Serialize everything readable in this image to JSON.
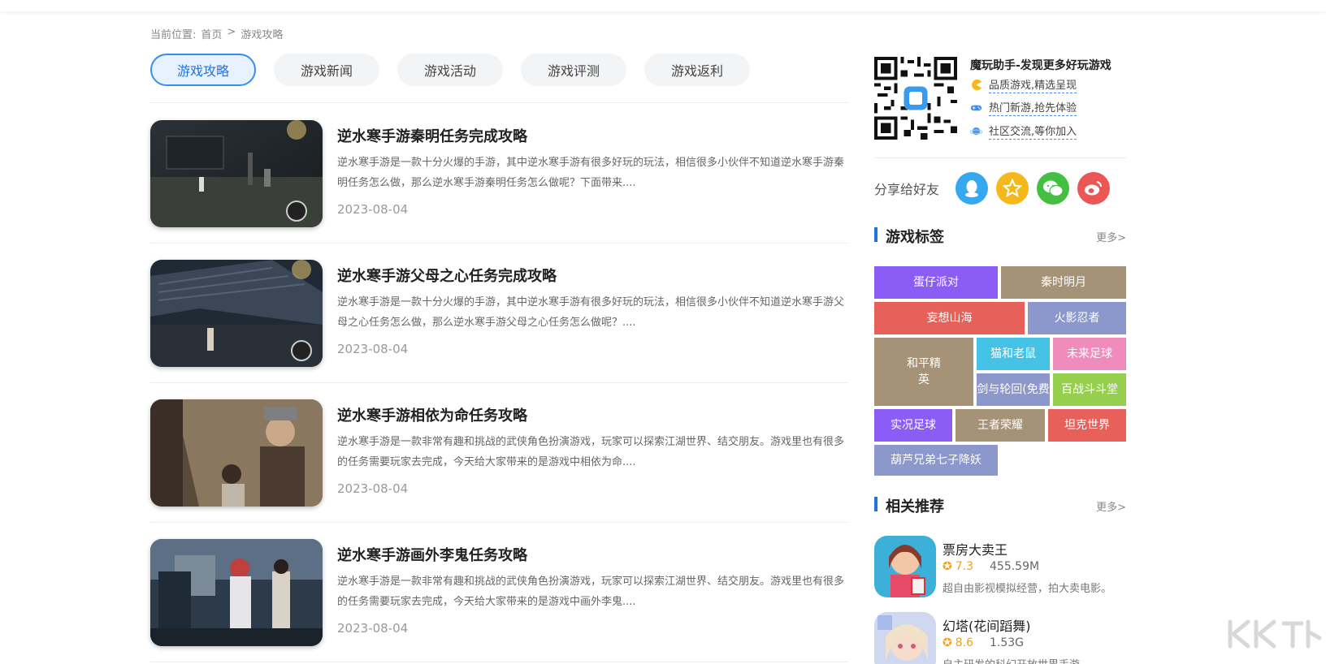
{
  "breadcrumb": {
    "prefix": "当前位置:",
    "home": "首页",
    "sep": ">",
    "current": "游戏攻略"
  },
  "tabs": [
    {
      "label": "游戏攻略",
      "active": true
    },
    {
      "label": "游戏新闻",
      "active": false
    },
    {
      "label": "游戏活动",
      "active": false
    },
    {
      "label": "游戏评测",
      "active": false
    },
    {
      "label": "游戏返利",
      "active": false
    }
  ],
  "articles": [
    {
      "title": "逆水寒手游秦明任务完成攻略",
      "desc": "逆水寒手游是一款十分火爆的手游，其中逆水寒手游有很多好玩的玩法，相信很多小伙伴不知道逆水寒手游秦明任务怎么做，那么逆水寒手游秦明任务怎么做呢？下面带来....",
      "date": "2023-08-04"
    },
    {
      "title": "逆水寒手游父母之心任务完成攻略",
      "desc": "逆水寒手游是一款十分火爆的手游，其中逆水寒手游有很多好玩的玩法，相信很多小伙伴不知道逆水寒手游父母之心任务怎么做，那么逆水寒手游父母之心任务怎么做呢？....",
      "date": "2023-08-04"
    },
    {
      "title": "逆水寒手游相依为命任务攻略",
      "desc": "逆水寒手游是一款非常有趣和挑战的武侠角色扮演游戏，玩家可以探索江湖世界、结交朋友。游戏里也有很多的任务需要玩家去完成，今天给大家带来的是游戏中相依为命....",
      "date": "2023-08-04"
    },
    {
      "title": "逆水寒手游画外李鬼任务攻略",
      "desc": "逆水寒手游是一款非常有趣和挑战的武侠角色扮演游戏，玩家可以探索江湖世界、结交朋友。游戏里也有很多的任务需要玩家去完成，今天给大家带来的是游戏中画外李鬼....",
      "date": "2023-08-04"
    }
  ],
  "promo": {
    "title": "魔玩助手-发现更多好玩游戏",
    "features": [
      "品质游戏,精选呈现",
      "热门新游,抢先体验",
      "社区交流,等你加入"
    ]
  },
  "share": {
    "label": "分享给好友",
    "buttons": [
      "qq-icon",
      "qzone-icon",
      "wechat-icon",
      "weibo-icon"
    ]
  },
  "tags_section": {
    "title": "游戏标签",
    "more": "更多>",
    "tags": [
      {
        "label": "蛋仔派对",
        "color": "#8b5cf6"
      },
      {
        "label": "秦时明月",
        "color": "#a69277"
      },
      {
        "label": "妄想山海",
        "color": "#e8605a"
      },
      {
        "label": "火影忍者",
        "color": "#8c97cc"
      },
      {
        "label": "和平精英",
        "color": "#a69277"
      },
      {
        "label": "猫和老鼠",
        "color": "#45c3e6"
      },
      {
        "label": "未来足球",
        "color": "#ef8cbc"
      },
      {
        "label": "剑与轮回(免费",
        "color": "#8c97cc"
      },
      {
        "label": "百战斗斗堂",
        "color": "#96cf4e"
      },
      {
        "label": "实况足球",
        "color": "#8b5cf6"
      },
      {
        "label": "王者荣耀",
        "color": "#a69277"
      },
      {
        "label": "坦克世界",
        "color": "#e8605a"
      },
      {
        "label": "葫芦兄弟七子降妖",
        "color": "#8c97cc"
      }
    ]
  },
  "recommend": {
    "title": "相关推荐",
    "more": "更多>",
    "items": [
      {
        "name": "票房大卖王",
        "rating": "7.3",
        "size": "455.59M",
        "desc": "超自由影视模拟经营，拍大卖电影。"
      },
      {
        "name": "幻塔(花间蹈舞)",
        "rating": "8.6",
        "size": "1.53G",
        "desc": "自主研发的科幻开放世界手游"
      }
    ]
  },
  "colors": {
    "accent": "#1f74e0",
    "tab_active_bg": "#e8f2ff"
  }
}
